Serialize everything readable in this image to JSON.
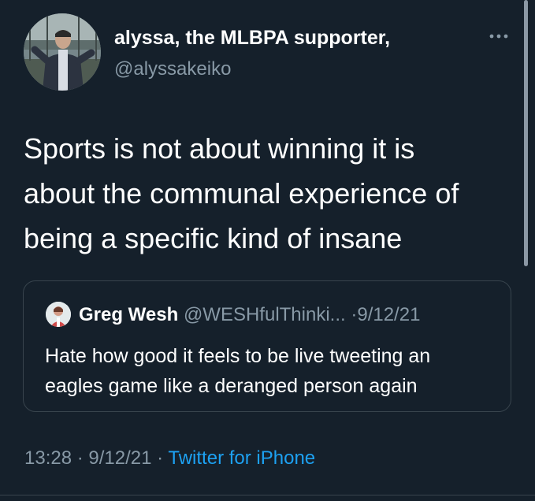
{
  "tweet": {
    "author": {
      "name": "alyssa, the MLBPA supporter,",
      "handle": "@alyssakeiko"
    },
    "text_lines": [
      "Sports is not about winning it is",
      "about the communal experience of",
      "being a specific kind of insane"
    ],
    "quoted": {
      "name": "Greg Wesh",
      "handle": "@WESHfulThinki...",
      "separator": "·",
      "date": "9/12/21",
      "text_lines": [
        "Hate how good it feels to be live tweeting an",
        "eagles game like a deranged person again"
      ]
    },
    "meta": {
      "time": "13:28",
      "separator": "·",
      "date": "9/12/21",
      "source": "Twitter for iPhone"
    }
  },
  "icons": {
    "more": "more-horizontal-icon"
  },
  "colors": {
    "background": "#15202b",
    "text_primary": "#ffffff",
    "text_secondary": "#8899a6",
    "link": "#1da1f2",
    "border": "#38444d"
  }
}
